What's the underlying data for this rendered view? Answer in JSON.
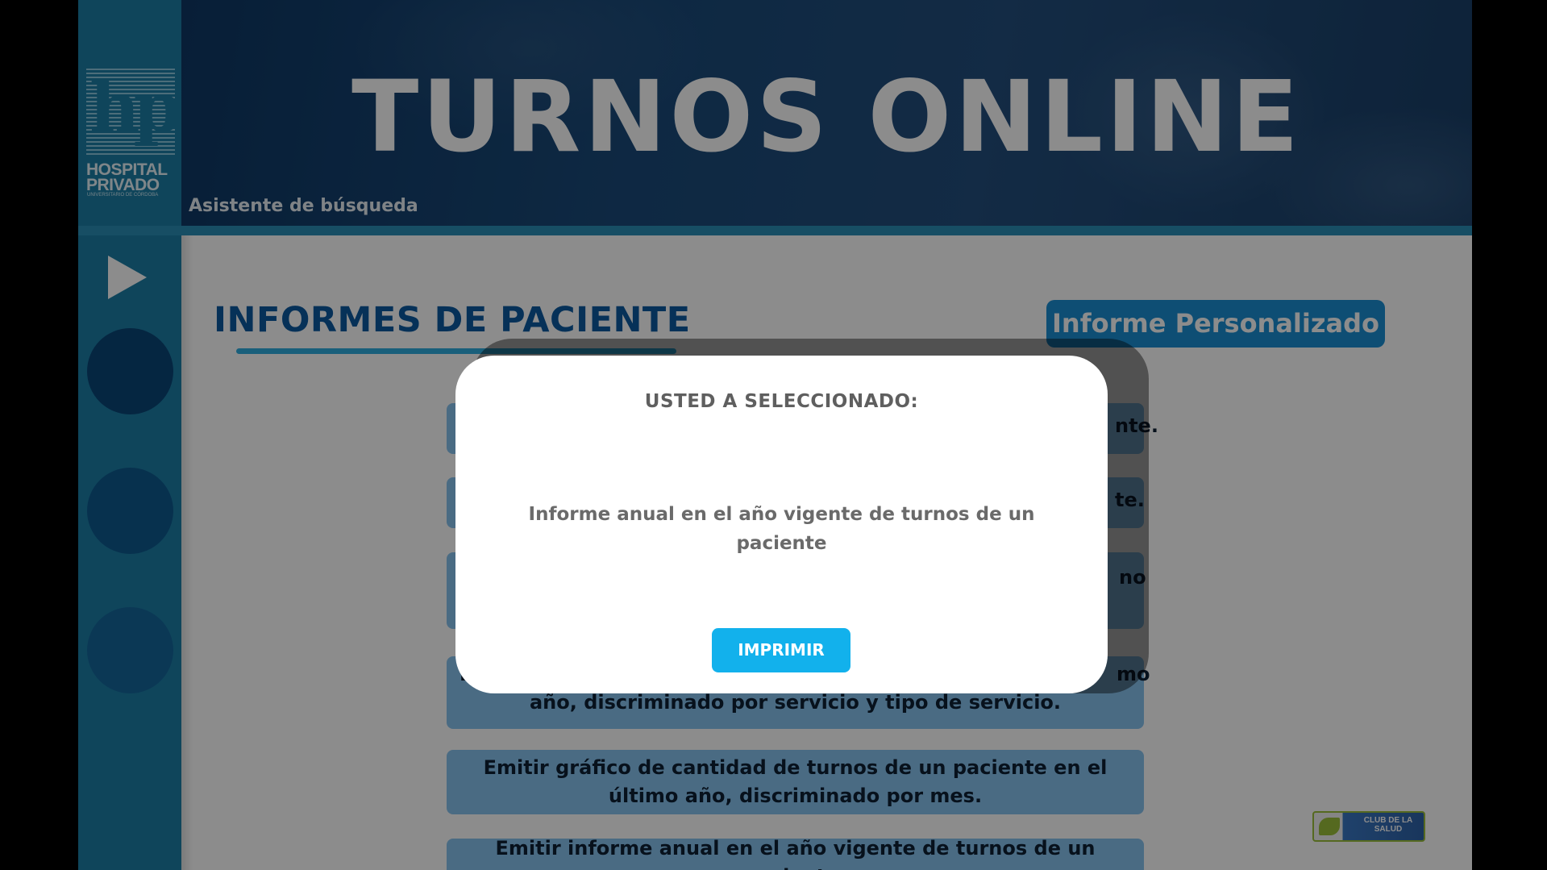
{
  "header": {
    "logo": {
      "line1": "HOSPITAL",
      "line2": "PRIVADO",
      "line3": "UNIVERSITARIO DE CÓRDOBA"
    },
    "title": "TURNOS ONLINE",
    "subtitle": "Asistente de búsqueda"
  },
  "sidebar": {
    "play_icon": "play-icon",
    "circles": [
      "nav-circle",
      "nav-circle",
      "nav-circle"
    ]
  },
  "content": {
    "section_title": "INFORMES DE PACIENTE",
    "custom_report_button": "Informe Personalizado",
    "options_visible_fragments": {
      "o1": "nte.",
      "o2": "te.",
      "o3": "no",
      "o4_line1_left": "E",
      "o4_line1_right": "mo",
      "o4_line2": "año, discriminado por servicio y tipo de servicio."
    },
    "options": [
      {
        "label": "Emitir gráfico de cantidad de turnos de un paciente en el último año, discriminado por mes."
      },
      {
        "label": "Emitir informe anual en el año vigente de turnos de un paciente."
      }
    ],
    "club_logo_text": "CLUB DE LA SALUD"
  },
  "modal": {
    "heading": "USTED A SELECCIONADO:",
    "selection": "Informe anual en el año vigente de turnos de un paciente",
    "print_button": "IMPRIMIR"
  },
  "colors": {
    "brand_blue": "#1d7fa7",
    "title_blue": "#0c5aa0",
    "option_blue": "#88c3ef",
    "print_button": "#12b1ec"
  }
}
